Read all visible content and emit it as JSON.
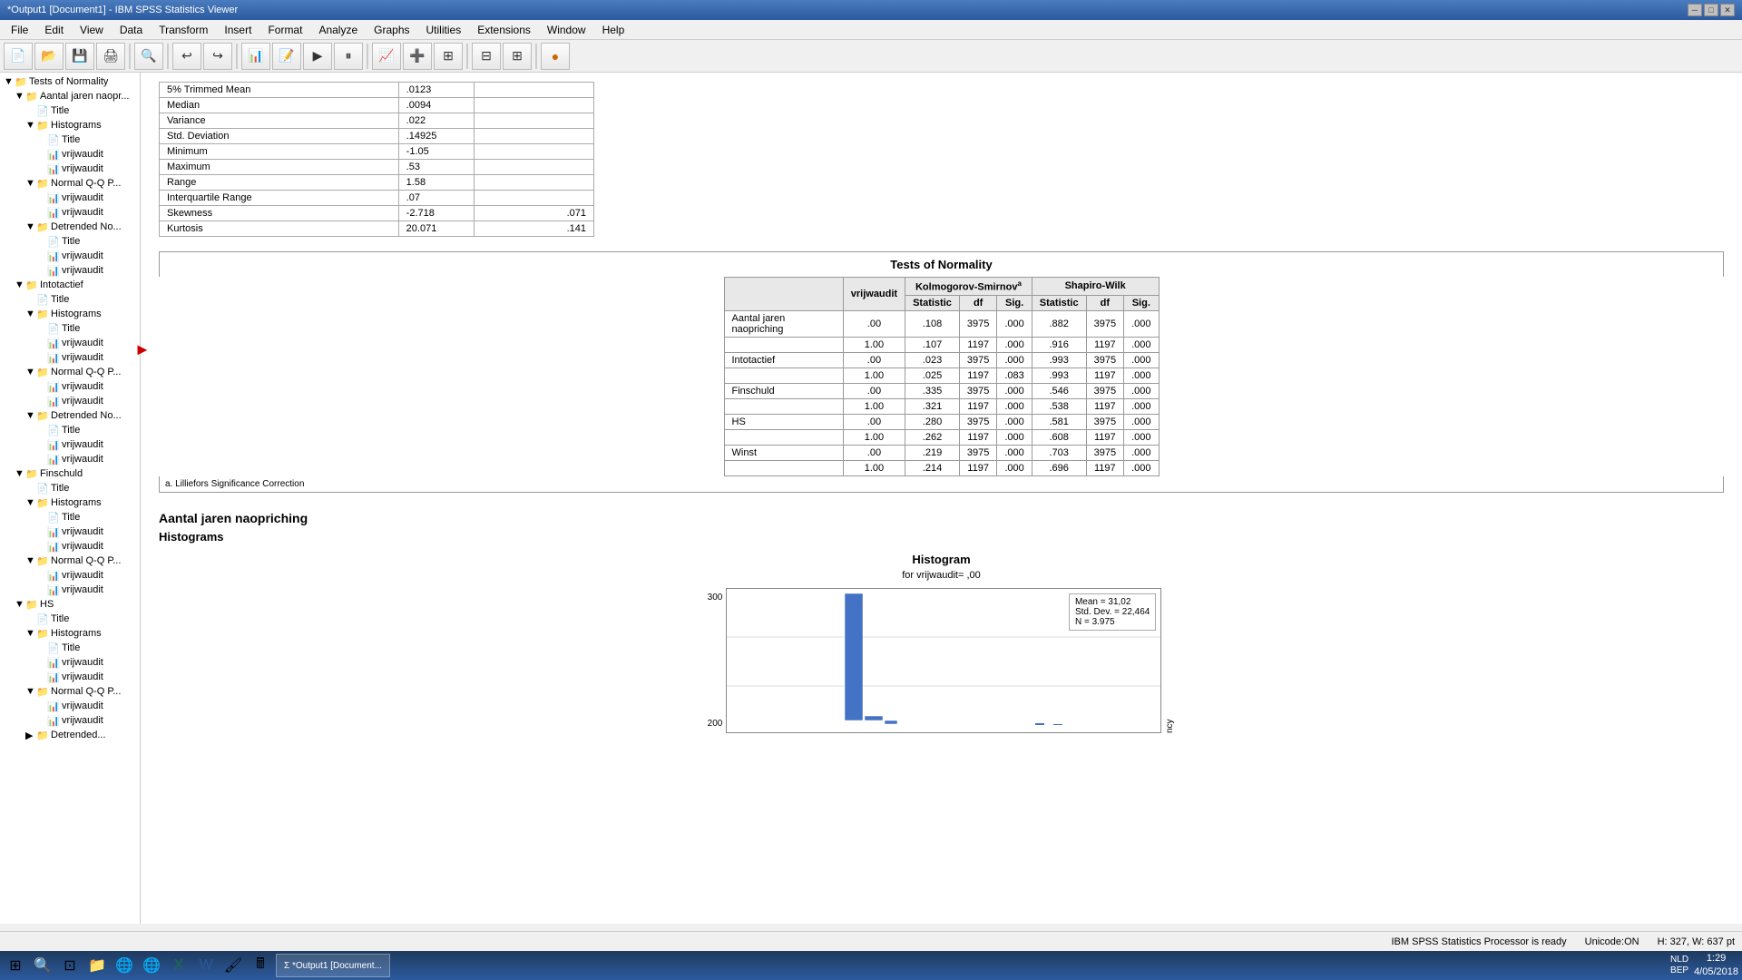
{
  "titleBar": {
    "title": "*Output1 [Document1] - IBM SPSS Statistics Viewer",
    "minimize": "─",
    "maximize": "□",
    "close": "✕"
  },
  "menuBar": {
    "items": [
      "File",
      "Edit",
      "View",
      "Data",
      "Transform",
      "Insert",
      "Format",
      "Analyze",
      "Graphs",
      "Utilities",
      "Extensions",
      "Window",
      "Help"
    ]
  },
  "tree": {
    "items": [
      {
        "label": "Tests of Normality",
        "level": 1,
        "type": "folder",
        "expanded": true
      },
      {
        "label": "Aantal jaren naopr...",
        "level": 2,
        "type": "folder",
        "expanded": true
      },
      {
        "label": "Title",
        "level": 3,
        "type": "doc"
      },
      {
        "label": "Histograms",
        "level": 3,
        "type": "folder",
        "expanded": true
      },
      {
        "label": "Title",
        "level": 4,
        "type": "doc"
      },
      {
        "label": "vrijwaudit",
        "level": 4,
        "type": "chart"
      },
      {
        "label": "vrijwaudit",
        "level": 4,
        "type": "chart"
      },
      {
        "label": "Normal Q-Q P...",
        "level": 3,
        "type": "folder",
        "expanded": true
      },
      {
        "label": "vrijwaudit",
        "level": 4,
        "type": "chart"
      },
      {
        "label": "vrijwaudit",
        "level": 4,
        "type": "chart"
      },
      {
        "label": "Detrended No...",
        "level": 3,
        "type": "folder",
        "expanded": true
      },
      {
        "label": "Title",
        "level": 4,
        "type": "doc"
      },
      {
        "label": "vrijwaudit",
        "level": 4,
        "type": "chart"
      },
      {
        "label": "vrijwaudit",
        "level": 4,
        "type": "chart"
      },
      {
        "label": "Intotactief",
        "level": 2,
        "type": "folder",
        "expanded": true
      },
      {
        "label": "Title",
        "level": 3,
        "type": "doc"
      },
      {
        "label": "Histograms",
        "level": 3,
        "type": "folder",
        "expanded": true
      },
      {
        "label": "Title",
        "level": 4,
        "type": "doc"
      },
      {
        "label": "vrijwaudit",
        "level": 4,
        "type": "chart"
      },
      {
        "label": "vrijwaudit",
        "level": 4,
        "type": "chart"
      },
      {
        "label": "Normal Q-Q P...",
        "level": 3,
        "type": "folder",
        "expanded": true
      },
      {
        "label": "vrijwaudit",
        "level": 4,
        "type": "chart"
      },
      {
        "label": "vrijwaudit",
        "level": 4,
        "type": "chart"
      },
      {
        "label": "Detrended No...",
        "level": 3,
        "type": "folder",
        "expanded": true
      },
      {
        "label": "Title",
        "level": 4,
        "type": "doc"
      },
      {
        "label": "vrijwaudit",
        "level": 4,
        "type": "chart"
      },
      {
        "label": "vrijwaudit",
        "level": 4,
        "type": "chart"
      },
      {
        "label": "Finschuld",
        "level": 2,
        "type": "folder",
        "expanded": true
      },
      {
        "label": "Title",
        "level": 3,
        "type": "doc"
      },
      {
        "label": "Histograms",
        "level": 3,
        "type": "folder",
        "expanded": true
      },
      {
        "label": "Title",
        "level": 4,
        "type": "doc"
      },
      {
        "label": "vrijwaudit",
        "level": 4,
        "type": "chart"
      },
      {
        "label": "vrijwaudit",
        "level": 4,
        "type": "chart"
      },
      {
        "label": "Normal Q-Q P...",
        "level": 3,
        "type": "folder",
        "expanded": true
      },
      {
        "label": "vrijwaudit",
        "level": 4,
        "type": "chart"
      },
      {
        "label": "vrijwaudit",
        "level": 4,
        "type": "chart"
      },
      {
        "label": "HS",
        "level": 2,
        "type": "folder",
        "expanded": true
      },
      {
        "label": "Title",
        "level": 3,
        "type": "doc"
      },
      {
        "label": "Histograms",
        "level": 3,
        "type": "folder",
        "expanded": true
      },
      {
        "label": "Title",
        "level": 4,
        "type": "doc"
      },
      {
        "label": "vrijwaudit",
        "level": 4,
        "type": "chart"
      },
      {
        "label": "vrijwaudit",
        "level": 4,
        "type": "chart"
      },
      {
        "label": "Normal Q-Q P...",
        "level": 3,
        "type": "folder",
        "expanded": true
      },
      {
        "label": "vrijwaudit",
        "level": 4,
        "type": "chart"
      },
      {
        "label": "vrijwaudit",
        "level": 4,
        "type": "chart"
      },
      {
        "label": "Detrended...",
        "level": 3,
        "type": "folder",
        "expanded": false
      }
    ]
  },
  "statsTable": {
    "rows": [
      {
        "label": "5% Trimmed Mean",
        "val1": ".0123",
        "val2": null
      },
      {
        "label": "Median",
        "val1": ".0094",
        "val2": null
      },
      {
        "label": "Variance",
        "val1": ".022",
        "val2": null
      },
      {
        "label": "Std. Deviation",
        "val1": ".14925",
        "val2": null
      },
      {
        "label": "Minimum",
        "val1": "-1.05",
        "val2": null
      },
      {
        "label": "Maximum",
        "val1": ".53",
        "val2": null
      },
      {
        "label": "Range",
        "val1": "1.58",
        "val2": null
      },
      {
        "label": "Interquartile Range",
        "val1": ".07",
        "val2": null
      },
      {
        "label": "Skewness",
        "val1": "-2.718",
        "val2": ".071"
      },
      {
        "label": "Kurtosis",
        "val1": "20.071",
        "val2": ".141"
      }
    ]
  },
  "normalityTable": {
    "title": "Tests of Normality",
    "kolmogorovHeader": "Kolmogorov-Smirnov",
    "kolmogorovSuperscript": "a",
    "shapiroHeader": "Shapiro-Wilk",
    "colHeaders": [
      "Statistic",
      "df",
      "Sig.",
      "Statistic",
      "df",
      "Sig."
    ],
    "rowLabel": "vrijwaudit",
    "rows": [
      {
        "variable": "Aantal jaren naopriching",
        "vrijwaudit": ".00",
        "ks_stat": ".108",
        "ks_df": "3975",
        "ks_sig": ".000",
        "sw_stat": ".882",
        "sw_df": "3975",
        "sw_sig": ".000"
      },
      {
        "variable": "",
        "vrijwaudit": "1.00",
        "ks_stat": ".107",
        "ks_df": "1197",
        "ks_sig": ".000",
        "sw_stat": ".916",
        "sw_df": "1197",
        "sw_sig": ".000"
      },
      {
        "variable": "Intotactief",
        "vrijwaudit": ".00",
        "ks_stat": ".023",
        "ks_df": "3975",
        "ks_sig": ".000",
        "sw_stat": ".993",
        "sw_df": "3975",
        "sw_sig": ".000"
      },
      {
        "variable": "",
        "vrijwaudit": "1.00",
        "ks_stat": ".025",
        "ks_df": "1197",
        "ks_sig": ".083",
        "sw_stat": ".993",
        "sw_df": "1197",
        "sw_sig": ".000"
      },
      {
        "variable": "Finschuld",
        "vrijwaudit": ".00",
        "ks_stat": ".335",
        "ks_df": "3975",
        "ks_sig": ".000",
        "sw_stat": ".546",
        "sw_df": "3975",
        "sw_sig": ".000"
      },
      {
        "variable": "",
        "vrijwaudit": "1.00",
        "ks_stat": ".321",
        "ks_df": "1197",
        "ks_sig": ".000",
        "sw_stat": ".538",
        "sw_df": "1197",
        "sw_sig": ".000"
      },
      {
        "variable": "HS",
        "vrijwaudit": ".00",
        "ks_stat": ".280",
        "ks_df": "3975",
        "ks_sig": ".000",
        "sw_stat": ".581",
        "sw_df": "3975",
        "sw_sig": ".000"
      },
      {
        "variable": "",
        "vrijwaudit": "1.00",
        "ks_stat": ".262",
        "ks_df": "1197",
        "ks_sig": ".000",
        "sw_stat": ".608",
        "sw_df": "1197",
        "sw_sig": ".000"
      },
      {
        "variable": "Winst",
        "vrijwaudit": ".00",
        "ks_stat": ".219",
        "ks_df": "3975",
        "ks_sig": ".000",
        "sw_stat": ".703",
        "sw_df": "3975",
        "sw_sig": ".000"
      },
      {
        "variable": "",
        "vrijwaudit": "1.00",
        "ks_stat": ".214",
        "ks_df": "1197",
        "ks_sig": ".000",
        "sw_stat": ".696",
        "sw_df": "1197",
        "sw_sig": ".000"
      }
    ],
    "footnote": "a. Lilliefors Significance Correction"
  },
  "sectionTitles": {
    "aantalJaren": "Aantal jaren naopriching",
    "histograms": "Histograms",
    "histogram": "Histogram",
    "histogramSubtitle": "for vrijwaudit= ,00"
  },
  "histogramLegend": {
    "line1": "Mean = 31,02",
    "line2": "Std. Dev. = 22,464",
    "line3": "N = 3.975"
  },
  "yAxisValues": [
    "300",
    "200"
  ],
  "statusBar": {
    "processor": "IBM SPSS Statistics Processor is ready",
    "unicode": "Unicode:ON",
    "dimensions": "H: 327, W: 637 pt"
  },
  "taskbar": {
    "time": "1:29",
    "date": "4/05/2018",
    "language": "NLD\nBEP",
    "appTitle": "*Output1 [Document1] - IBM SPSS Statistics Viewer"
  }
}
